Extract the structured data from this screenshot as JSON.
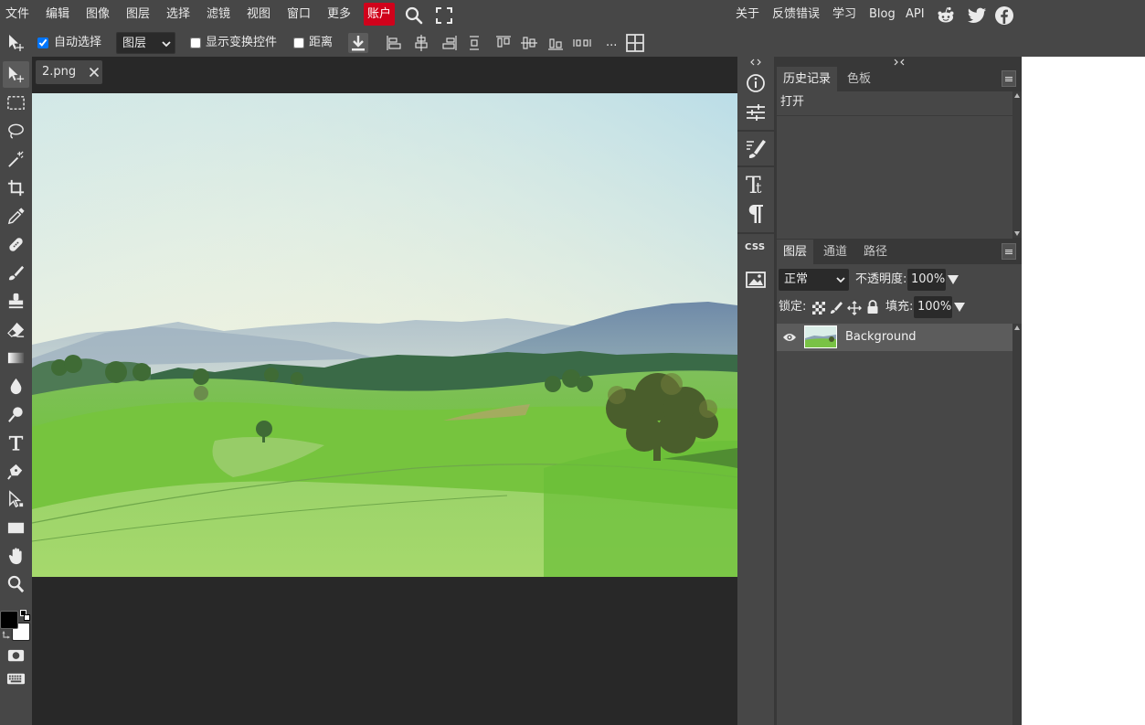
{
  "menu": {
    "items": [
      "文件",
      "编辑",
      "图像",
      "图层",
      "选择",
      "滤镜",
      "视图",
      "窗口",
      "更多"
    ],
    "account": "账户",
    "right_links": [
      "关于",
      "反馈错误",
      "学习",
      "Blog",
      "API"
    ],
    "icons": [
      "search-icon",
      "fullscreen-icon",
      "reddit-icon",
      "twitter-icon",
      "facebook-icon"
    ]
  },
  "options": {
    "auto_select_label": "自动选择",
    "auto_select_checked": true,
    "layer_select_value": "图层",
    "show_transform_label": "显示变换控件",
    "distance_label": "距离",
    "more_label": "..."
  },
  "document": {
    "tab_name": "2.png",
    "close_glyph": "✕"
  },
  "panels": {
    "history_tabs": [
      "历史记录",
      "色板"
    ],
    "history_items": [
      "打开"
    ],
    "layer_tabs": [
      "图层",
      "通道",
      "路径"
    ],
    "blend_mode": "正常",
    "opacity_label": "不透明度:",
    "opacity_value": "100%",
    "lock_label": "锁定:",
    "fill_label": "填充:",
    "fill_value": "100%",
    "layers": [
      {
        "name": "Background",
        "visible": true
      }
    ]
  },
  "strip": {
    "css_label": "CSS"
  },
  "colors": {
    "chrome": "#474747",
    "dark": "#383838",
    "canvas_bg": "#282828",
    "accent_account": "#d0021b",
    "foreground": "#000000",
    "background": "#ffffff"
  }
}
